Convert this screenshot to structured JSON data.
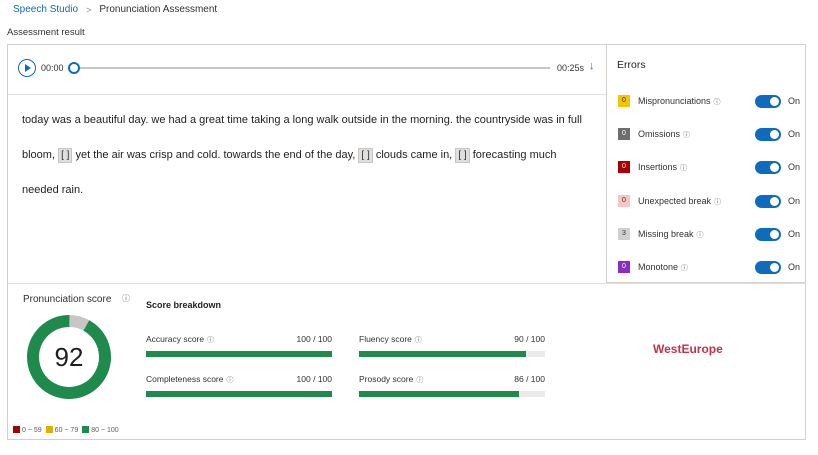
{
  "breadcrumb": {
    "root": "Speech Studio",
    "separator": ">",
    "current": "Pronunciation Assessment"
  },
  "section_title": "Assessment result",
  "player": {
    "time_start": "00:00",
    "time_end": "00:25s",
    "play_icon": "play-icon",
    "download_icon": "download-icon",
    "progress": 0
  },
  "transcript": {
    "p1": "today was a beautiful day. we had a great time taking a long walk outside in the morning. the countryside was in full bloom,",
    "gap": "[ ]",
    "p2": "yet the air was crisp and cold. towards the end of the day,",
    "p3": "clouds came in,",
    "p4": "forecasting much needed rain."
  },
  "errors": {
    "title": "Errors",
    "items": [
      {
        "label": "Mispronunciations",
        "badge": "0",
        "color": "#f3c400",
        "state": "On"
      },
      {
        "label": "Omissions",
        "badge": "0",
        "color": "#6e6e6e",
        "state": "On"
      },
      {
        "label": "Insertions",
        "badge": "0",
        "color": "#a80000",
        "state": "On"
      },
      {
        "label": "Unexpected break",
        "badge": "0",
        "color": "#f4c7c3",
        "state": "On"
      },
      {
        "label": "Missing break",
        "badge": "3",
        "color": "#d2d0ce",
        "state": "On"
      },
      {
        "label": "Monotone",
        "badge": "0",
        "color": "#8a2ebf",
        "state": "On"
      }
    ]
  },
  "pronunciation_score": {
    "title": "Pronunciation score",
    "value": "92",
    "score": 92,
    "ring_color": "#1e8a4c",
    "track_color": "#c8c6c4"
  },
  "legend": [
    {
      "label": "0 ~ 59",
      "color": "#a80000"
    },
    {
      "label": "60 ~ 79",
      "color": "#e0b000"
    },
    {
      "label": "80 ~ 100",
      "color": "#1e8a4c"
    }
  ],
  "breakdown": {
    "title": "Score breakdown",
    "metrics": [
      {
        "label": "Accuracy score",
        "value": "100 / 100",
        "score": 100
      },
      {
        "label": "Fluency score",
        "value": "90 / 100",
        "score": 90
      },
      {
        "label": "Completeness score",
        "value": "100 / 100",
        "score": 100
      },
      {
        "label": "Prosody score",
        "value": "86 / 100",
        "score": 86
      }
    ]
  },
  "region": "WestEurope"
}
